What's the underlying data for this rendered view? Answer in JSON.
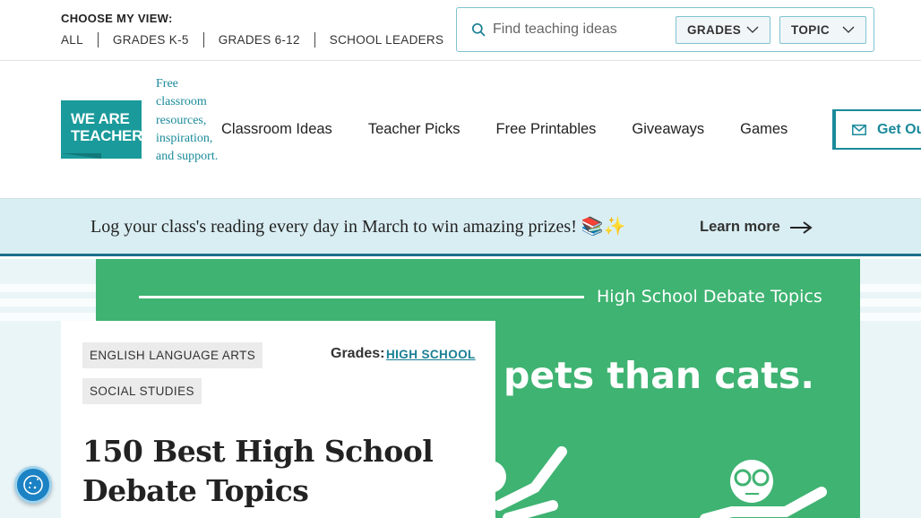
{
  "topbar": {
    "view_label": "CHOOSE MY VIEW:",
    "views": [
      "ALL",
      "GRADES K-5",
      "GRADES 6-12",
      "SCHOOL LEADERS"
    ],
    "search": {
      "placeholder": "Find teaching ideas",
      "value": "",
      "icon": "search-icon"
    },
    "filters": {
      "grades": "GRADES",
      "topic": "TOPIC"
    }
  },
  "header": {
    "logo_line1": "WE ARE",
    "logo_line2": "TEACHERS",
    "tagline": "Free classroom resources, inspiration, and support.",
    "nav": [
      "Classroom Ideas",
      "Teacher Picks",
      "Free Printables",
      "Giveaways",
      "Games"
    ],
    "cta": "Get Ou"
  },
  "banner": {
    "text": "Log your class's reading every day in March to win amazing prizes! 📚✨",
    "link": "Learn more"
  },
  "hero": {
    "caption": "High School Debate Topics",
    "quote": "pets than cats."
  },
  "article": {
    "tags": [
      "ENGLISH LANGUAGE ARTS",
      "SOCIAL STUDIES"
    ],
    "grades_label": "Grades:",
    "grades_value": "HIGH SCHOOL",
    "title": "150 Best High School Debate Topics"
  },
  "colors": {
    "brand_teal": "#1a9a9b",
    "hero_green": "#3fb372",
    "banner_bg": "#d9eef3",
    "accent_blue": "#1a7f94"
  }
}
